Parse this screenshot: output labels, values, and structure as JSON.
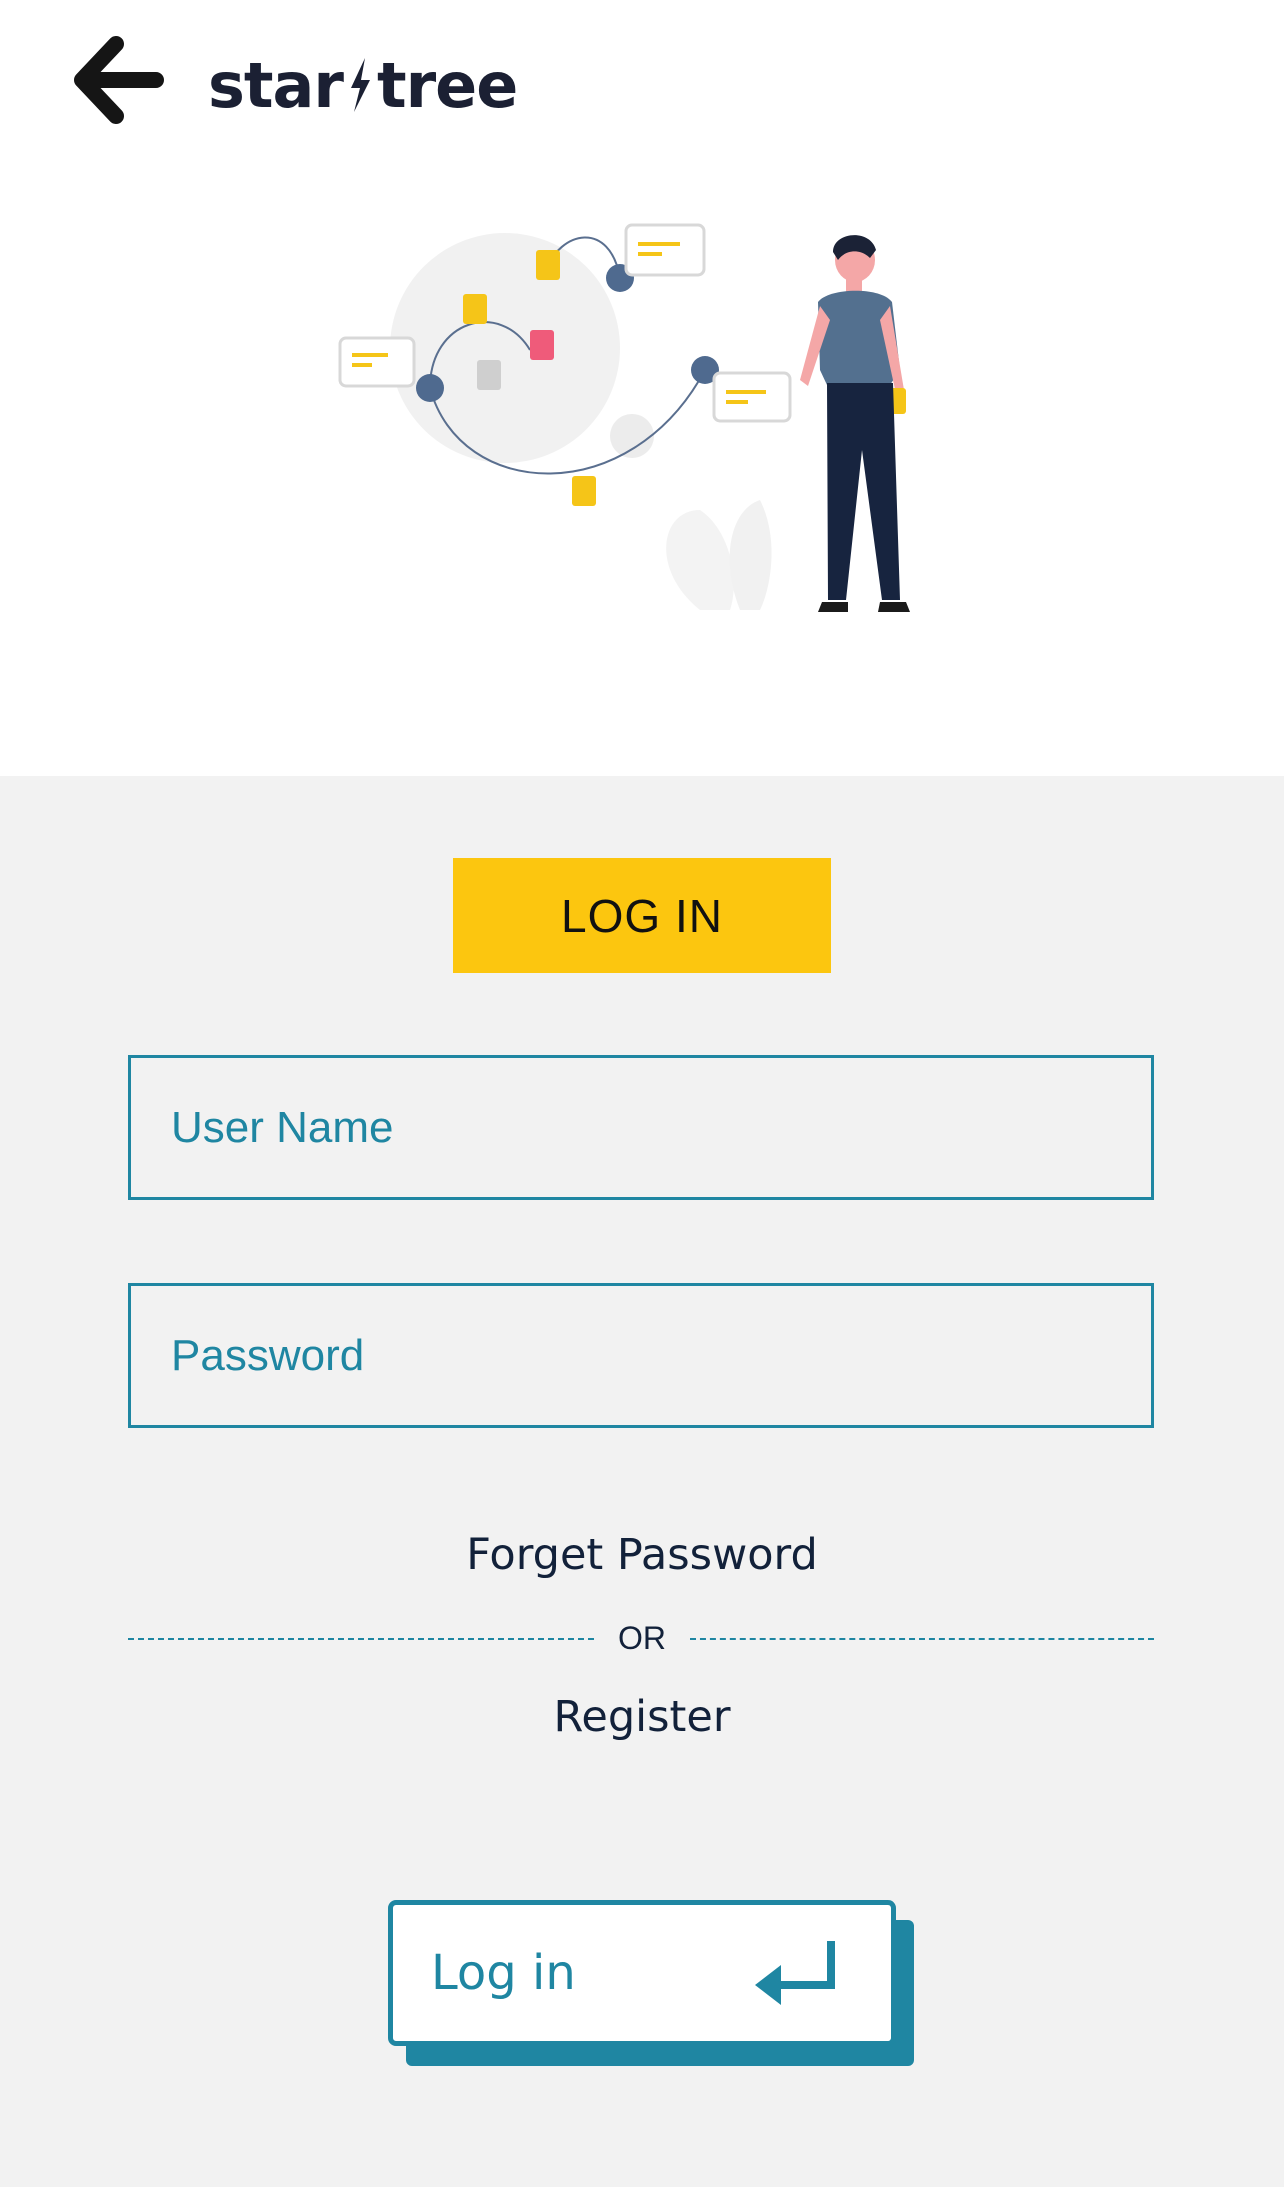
{
  "header": {
    "back_icon": "arrow-left-icon",
    "logo_part1": "star",
    "logo_part2": "tree",
    "logo_icon": "lightning-bolt-icon"
  },
  "hero": {
    "illustration": "person-with-connected-documents-illustration"
  },
  "form": {
    "tab_label": "LOG IN",
    "username_placeholder": "User Name",
    "username_value": "",
    "password_placeholder": "Password",
    "password_value": "",
    "forget_password": "Forget Password",
    "or_label": "OR",
    "register": "Register",
    "submit_label": "Log in",
    "submit_icon": "enter-return-icon"
  },
  "colors": {
    "accent_yellow": "#fcc60f",
    "accent_teal": "#1f86a2",
    "panel_bg": "#f2f2f2",
    "text_dark": "#12213a"
  }
}
